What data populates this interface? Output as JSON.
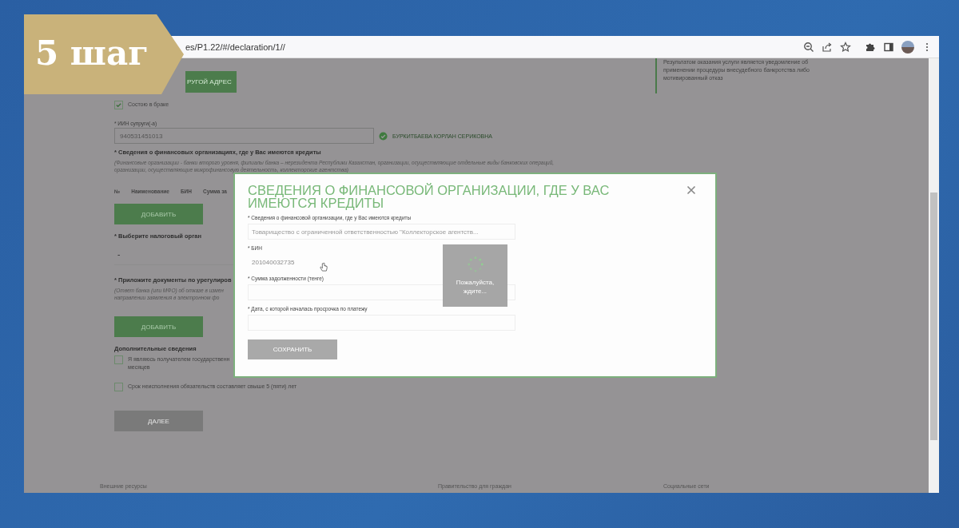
{
  "badge": {
    "text": "5 шаг"
  },
  "browser": {
    "url": "es/P1.22/#/declaration/1//"
  },
  "form": [
    {
      "kind": "cut_button",
      "text": "РУГОЙ АДРЕС",
      "disabled": false
    },
    {
      "kind": "checkbox",
      "lines": [
        "Состою в браке"
      ],
      "checked": true
    },
    {
      "kind": "label",
      "text": "* ИИН супруги(-а)"
    },
    {
      "kind": "verified_field",
      "value": "940531451013",
      "verified_name": "БУРКИТБАЕВА КОРЛАН СЕРИКОВНА"
    },
    {
      "kind": "heading",
      "text": "* Сведения о финансовых организациях, где у Вас имеются кредиты"
    },
    {
      "kind": "note",
      "lines": [
        "(Финансовые организации - банки второго уровня, филиалы банка – нерезидента Республики Казахстан, организации, осуществляющие отдельные виды банковских операций,",
        "организации, осуществляющие микрофинансовую деятельность, коллекторские агентства)"
      ]
    },
    {
      "kind": "columns",
      "cells": [
        "№",
        "Наименование",
        "БИН",
        "Сумма за"
      ]
    },
    {
      "kind": "button",
      "text": "ДОБАВИТЬ",
      "disabled": false
    },
    {
      "kind": "heading",
      "text": "* Выберите налоговый орган"
    },
    {
      "kind": "select",
      "value": "-"
    },
    {
      "kind": "heading",
      "text": "* Приложите документы по урегулиров"
    },
    {
      "kind": "note",
      "lines": [
        "(Ответ банка (или МФО) об отказе в измен",
        "направлении заявления в электронном фо"
      ]
    },
    {
      "kind": "button",
      "text": "ДОБАВИТЬ",
      "disabled": false
    },
    {
      "kind": "heading",
      "text": "Дополнительные сведения"
    },
    {
      "kind": "checkbox",
      "lines": [
        "Я являюсь получателем государственн",
        "месяцев"
      ],
      "checked": false
    },
    {
      "kind": "checkbox",
      "lines": [
        "Срок неисполнения обязательств составляет свыше 5 (пяти) лет"
      ],
      "checked": false
    },
    {
      "kind": "button",
      "text": "ДАЛЕЕ",
      "disabled": true
    }
  ],
  "info": "Результатом оказания услуги является уведомление об применении процедуры внесудебного банкротства либо мотивированный отказ",
  "footer": [
    "Внешние ресурсы",
    "Правительство для граждан",
    "Социальные сети"
  ],
  "modal": {
    "title": "СВЕДЕНИЯ О ФИНАНСОВОЙ ОРГАНИЗАЦИИ, ГДЕ У ВАС ИМЕЮТСЯ КРЕДИТЫ",
    "fields": [
      {
        "label": "* Сведения о финансовой организации, где у Вас имеются кредиты",
        "value": "Товарищество с ограниченной ответственностью \"Коллекторское агентств...",
        "disabled": false
      },
      {
        "label": "* БИН",
        "value": "201040032735",
        "disabled": true
      },
      {
        "label": "* Сумма задолженности (тенге)",
        "disabled": false
      },
      {
        "label": "* Дата, с которой началась просрочка по платежу",
        "disabled": false
      }
    ],
    "save_button": {
      "text": "СОХРАНИТЬ",
      "disabled": true
    },
    "loading": {
      "text": "Пожалуйста, ждите..."
    }
  }
}
